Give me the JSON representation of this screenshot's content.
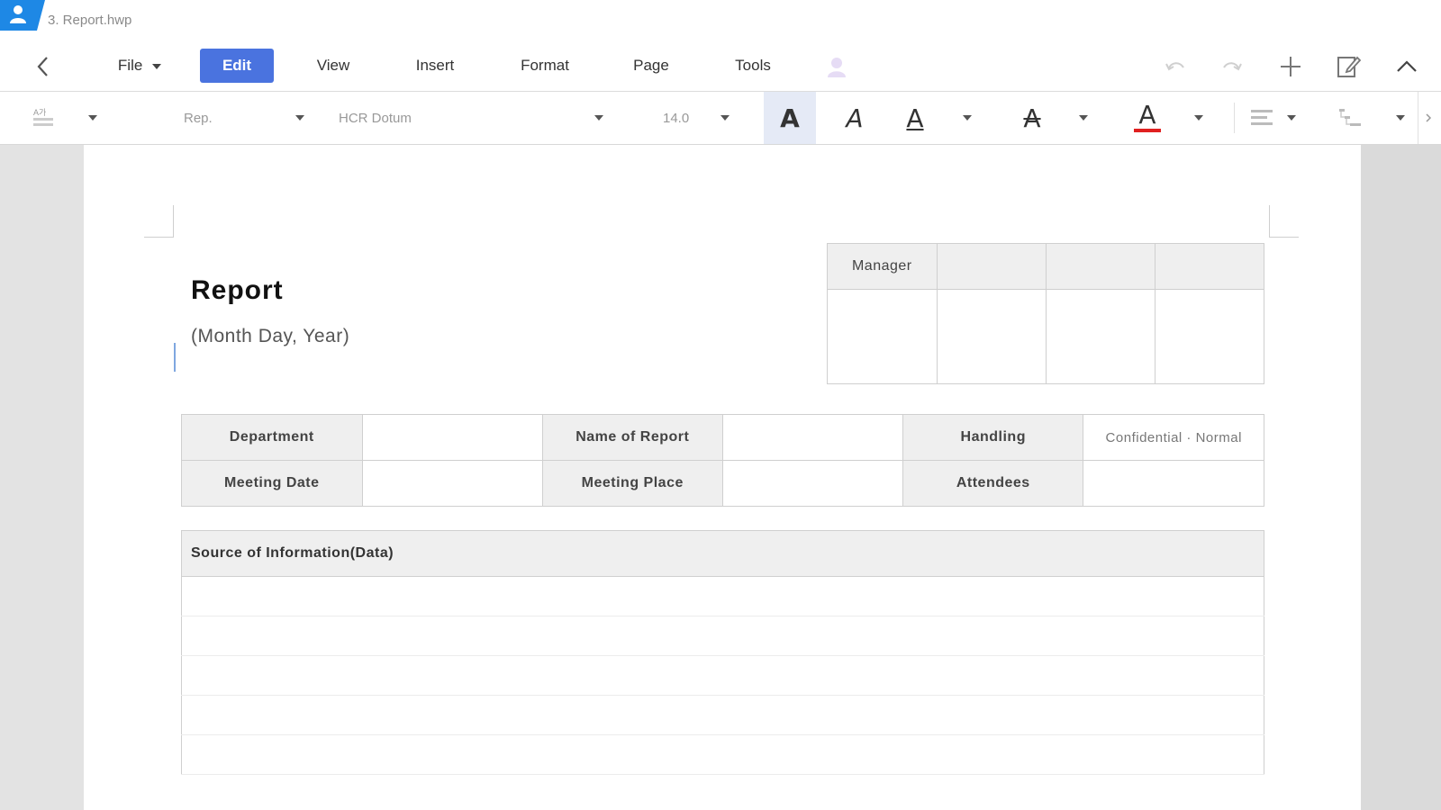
{
  "window": {
    "title": "3. Report.hwp"
  },
  "menu": {
    "file": "File",
    "edit": "Edit",
    "view": "View",
    "insert": "Insert",
    "format": "Format",
    "page": "Page",
    "tools": "Tools",
    "active": "Edit"
  },
  "toolbar": {
    "style_value": "Rep.",
    "font_value": "HCR Dotum",
    "size_value": "14.0",
    "accent_color": "#4a73df",
    "font_color_swatch": "#e02020"
  },
  "document": {
    "title": "Report",
    "date_placeholder": "(Month  Day,  Year)",
    "approval": {
      "header_label": "Manager"
    },
    "meta": {
      "row1": [
        "Department",
        "",
        "Name of Report",
        "",
        "Handling",
        "Confidential · Normal"
      ],
      "row2": [
        "Meeting Date",
        "",
        "Meeting Place",
        "",
        "Attendees",
        ""
      ]
    },
    "source_header": "Source of Information(Data)"
  }
}
